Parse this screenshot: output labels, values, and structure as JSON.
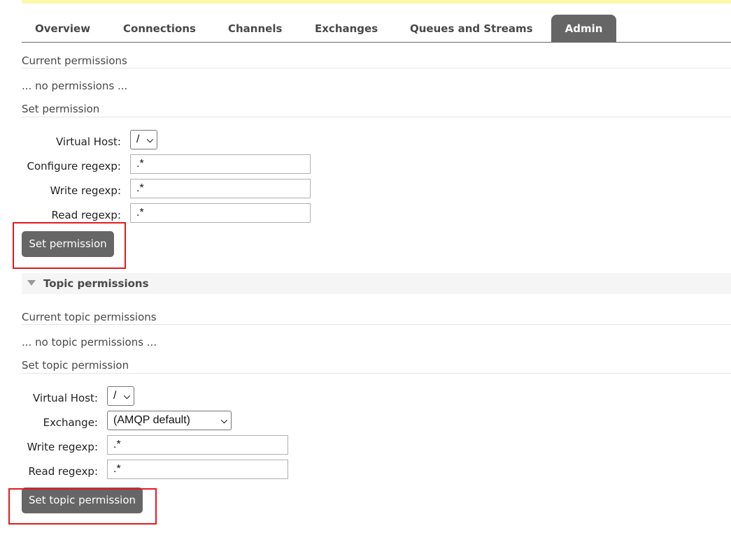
{
  "nav": {
    "tabs": [
      {
        "label": "Overview"
      },
      {
        "label": "Connections"
      },
      {
        "label": "Channels"
      },
      {
        "label": "Exchanges"
      },
      {
        "label": "Queues and Streams"
      },
      {
        "label": "Admin",
        "active": true
      }
    ]
  },
  "permissions": {
    "current_label": "Current permissions",
    "none_text": "... no permissions ...",
    "set_label": "Set permission",
    "vhost_label": "Virtual Host:",
    "vhost_value": "/",
    "configure_label": "Configure regexp:",
    "configure_value": ".*",
    "write_label": "Write regexp:",
    "write_value": ".*",
    "read_label": "Read regexp:",
    "read_value": ".*",
    "button_label": "Set permission"
  },
  "topic_permissions": {
    "section_title": "Topic permissions",
    "current_label": "Current topic permissions",
    "none_text": "... no topic permissions ...",
    "set_label": "Set topic permission",
    "vhost_label": "Virtual Host:",
    "vhost_value": "/",
    "exchange_label": "Exchange:",
    "exchange_value": "(AMQP default)",
    "write_label": "Write regexp:",
    "write_value": ".*",
    "read_label": "Read regexp:",
    "read_value": ".*",
    "button_label": "Set topic permission"
  },
  "colors": {
    "accent_tab": "#666666",
    "highlight": "#e3191f",
    "top_banner": "#fbf8a8"
  },
  "icons": {
    "collapse": "triangle-down-icon",
    "select": "chevron-down-icon"
  }
}
